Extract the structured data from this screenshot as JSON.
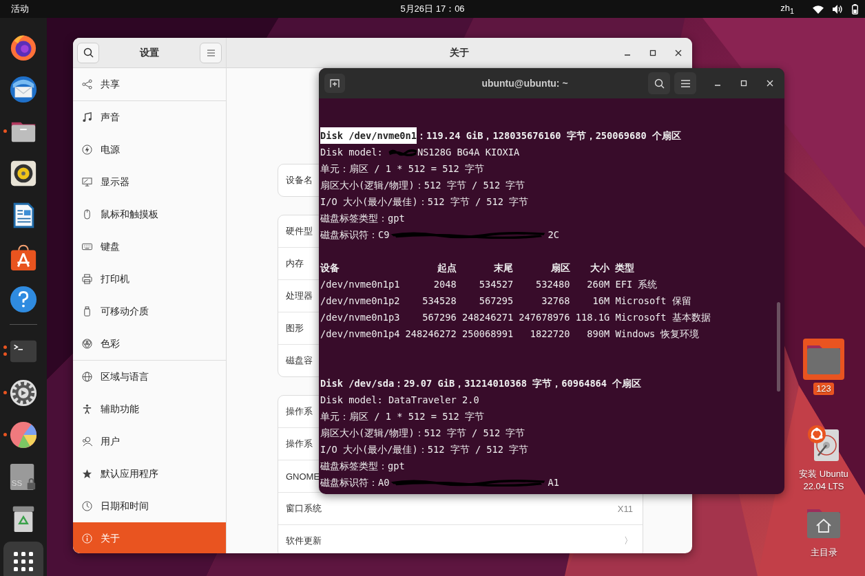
{
  "top_bar": {
    "activities": "活动",
    "clock": "5月26日 17：06",
    "input_method": "zh$_{1}$"
  },
  "dock": {
    "items": [
      {
        "kind": "firefox",
        "running": false,
        "multiple": false
      },
      {
        "kind": "mail",
        "running": false,
        "multiple": false
      },
      {
        "kind": "files",
        "running": true,
        "multiple": false
      },
      {
        "kind": "music",
        "running": false,
        "multiple": false
      },
      {
        "kind": "writer",
        "running": false,
        "multiple": false
      },
      {
        "kind": "software",
        "running": false,
        "multiple": false
      },
      {
        "kind": "help",
        "running": false,
        "multiple": false
      },
      {
        "kind": "separator"
      },
      {
        "kind": "terminal",
        "running": true,
        "multiple": true
      },
      {
        "kind": "settings",
        "running": true,
        "multiple": false
      },
      {
        "kind": "disk-usage",
        "running": true,
        "multiple": false
      },
      {
        "kind": "drive",
        "label": "SS",
        "running": false,
        "multiple": false
      },
      {
        "kind": "trash",
        "running": false,
        "multiple": false
      },
      {
        "kind": "apps",
        "running": false,
        "multiple": false
      }
    ]
  },
  "settings_window": {
    "sidebar_title": "设置",
    "title": "关于",
    "sidebar_groups": [
      [
        {
          "label": "共享",
          "kind": "share",
          "selected": false
        }
      ],
      [
        {
          "label": "声音",
          "kind": "sound",
          "selected": false
        },
        {
          "label": "电源",
          "kind": "power",
          "selected": false
        },
        {
          "label": "显示器",
          "kind": "display",
          "selected": false
        },
        {
          "label": "鼠标和触摸板",
          "kind": "mouse",
          "selected": false
        },
        {
          "label": "键盘",
          "kind": "keyboard",
          "selected": false
        },
        {
          "label": "打印机",
          "kind": "printer",
          "selected": false
        },
        {
          "label": "可移动介质",
          "kind": "removable",
          "selected": false
        },
        {
          "label": "色彩",
          "kind": "color",
          "selected": false
        }
      ],
      [
        {
          "label": "区域与语言",
          "kind": "region",
          "selected": false
        },
        {
          "label": "辅助功能",
          "kind": "accessibility",
          "selected": false
        },
        {
          "label": "用户",
          "kind": "users",
          "selected": false
        },
        {
          "label": "默认应用程序",
          "kind": "star",
          "selected": false
        },
        {
          "label": "日期和时间",
          "kind": "clock",
          "selected": false
        },
        {
          "label": "关于",
          "kind": "about",
          "selected": true
        }
      ]
    ],
    "cards": [
      [
        {
          "label": "设备名"
        }
      ],
      [
        {
          "label": "硬件型"
        },
        {
          "label": "内存"
        },
        {
          "label": "处理器"
        },
        {
          "label": "图形"
        },
        {
          "label": "磁盘容"
        }
      ],
      [
        {
          "label": "操作系"
        },
        {
          "label": "操作系"
        },
        {
          "label": "GNOME"
        },
        {
          "label": "窗口系统",
          "value": "X11"
        },
        {
          "label": "软件更新",
          "value": "〉"
        }
      ]
    ]
  },
  "terminal": {
    "title": "ubuntu@ubuntu: ~",
    "sections": [
      {
        "heading": [
          {
            "text": "Disk /dev/nvme0n1",
            "selected": true
          },
          {
            "text": "：119.24 GiB，128035676160 字节，250069680 个扇区",
            "selected": false
          }
        ],
        "lines": [
          {
            "kind": "redacted",
            "prefix": "Disk model: ",
            "suffix": "NS128G BG4A KIOXIA"
          },
          {
            "kind": "text",
            "text": "单元：扇区 / 1 * 512 = 512 字节"
          },
          {
            "kind": "text",
            "text": "扇区大小(逻辑/物理)：512 字节 / 512 字节"
          },
          {
            "kind": "text",
            "text": "I/O 大小(最小/最佳)：512 字节 / 512 字节"
          },
          {
            "kind": "text",
            "text": "磁盘标签类型：gpt"
          },
          {
            "kind": "redacted",
            "prefix": "磁盘标识符：C9",
            "suffix": "2C"
          }
        ],
        "table": {
          "columns": [
            "设备",
            "起点",
            "末尾",
            "扇区",
            "大小",
            "类型"
          ],
          "rows": [
            [
              "/dev/nvme0n1p1",
              "2048",
              "534527",
              "532480",
              "260M",
              "EFI 系统"
            ],
            [
              "/dev/nvme0n1p2",
              "534528",
              "567295",
              "32768",
              "16M",
              "Microsoft 保留"
            ],
            [
              "/dev/nvme0n1p3",
              "567296",
              "248246271",
              "247678976",
              "118.1G",
              "Microsoft 基本数据"
            ],
            [
              "/dev/nvme0n1p4",
              "248246272",
              "250068991",
              "1822720",
              "890M",
              "Windows 恢复环境"
            ]
          ]
        }
      },
      {
        "heading": [
          {
            "text": "Disk /dev/sda：29.07 GiB，31214010368 字节，60964864 个扇区",
            "selected": false
          }
        ],
        "lines": [
          {
            "kind": "text",
            "text": "Disk model: DataTraveler 2.0"
          },
          {
            "kind": "text",
            "text": "单元：扇区 / 1 * 512 = 512 字节"
          },
          {
            "kind": "text",
            "text": "扇区大小(逻辑/物理)：512 字节 / 512 字节"
          },
          {
            "kind": "text",
            "text": "I/O 大小(最小/最佳)：512 字节 / 512 字节"
          },
          {
            "kind": "text",
            "text": "磁盘标签类型：gpt"
          },
          {
            "kind": "redacted",
            "prefix": "磁盘标识符：A0",
            "suffix": "A1"
          }
        ]
      }
    ]
  },
  "desktop_icons": [
    {
      "kind": "folder",
      "label": [
        "123"
      ],
      "selected": true
    },
    {
      "kind": "installer",
      "label": [
        "安装 Ubuntu",
        "22.04 LTS"
      ],
      "selected": false
    },
    {
      "kind": "home",
      "label": [
        "主目录"
      ],
      "selected": false
    }
  ]
}
